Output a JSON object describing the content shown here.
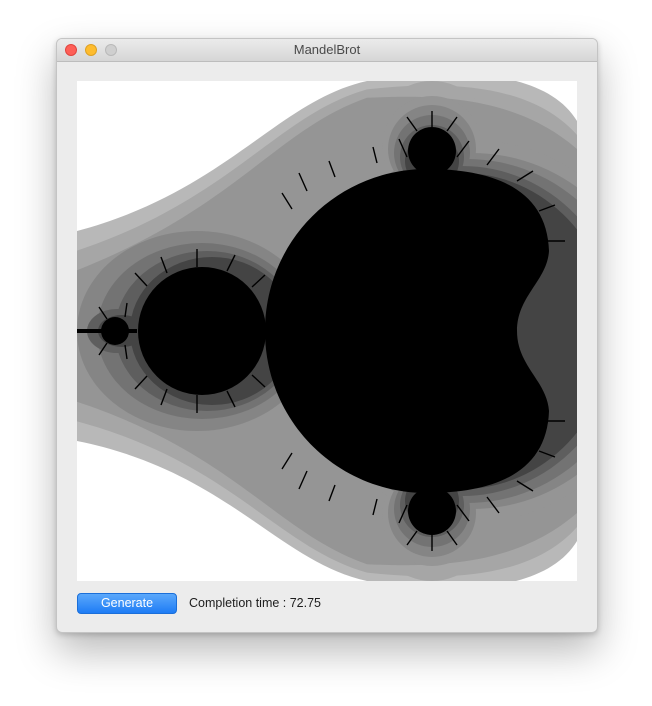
{
  "window": {
    "title": "MandelBrot"
  },
  "canvas": {
    "fractal": "mandelbrot-set",
    "palette": [
      "#ffffff",
      "#b8b8b8",
      "#a6a6a6",
      "#959595",
      "#858585",
      "#737373",
      "#5e5e5e",
      "#444444",
      "#000000"
    ]
  },
  "controls": {
    "generate_label": "Generate",
    "status_text": "Completion time : 72.75"
  },
  "colors": {
    "accent": "#1e7cf5",
    "window_bg": "#ececec"
  }
}
